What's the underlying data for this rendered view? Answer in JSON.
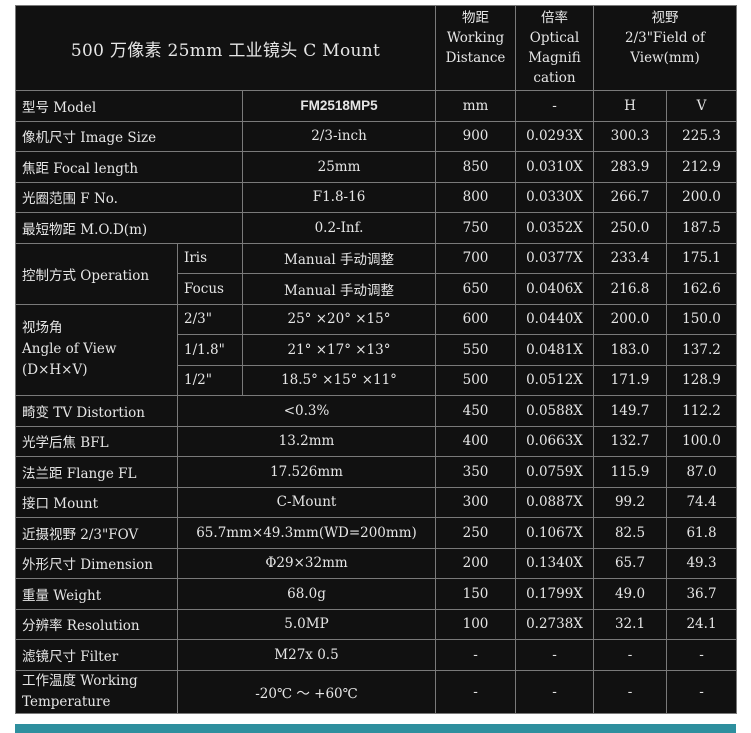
{
  "header": {
    "title": "500 万像素 25mm 工业镜头 C Mount",
    "col_distance": "物距\nWorking\nDistance",
    "col_magnification": "倍率\nOptical\nMagnifi\ncation",
    "col_fov": "视野\n2/3\"Field of\nView(mm)"
  },
  "rows": [
    {
      "label": "型号 Model",
      "value": "FM2518MP5",
      "d": "mm",
      "m": "-",
      "h": "H",
      "v": "V"
    },
    {
      "label": "像机尺寸 Image Size",
      "value": "2/3-inch",
      "d": "900",
      "m": "0.0293X",
      "h": "300.3",
      "v": "225.3"
    },
    {
      "label": "焦距 Focal length",
      "value": "25mm",
      "d": "850",
      "m": "0.0310X",
      "h": "283.9",
      "v": "212.9"
    },
    {
      "label": "光圈范围 F No.",
      "value": "F1.8-16",
      "d": "800",
      "m": "0.0330X",
      "h": "266.7",
      "v": "200.0"
    },
    {
      "label": "最短物距 M.O.D(m)",
      "value": "0.2-Inf.",
      "d": "750",
      "m": "0.0352X",
      "h": "250.0",
      "v": "187.5"
    },
    {
      "label": "控制方式 Operation",
      "sub": "Iris",
      "value": "Manual 手动调整",
      "d": "700",
      "m": "0.0377X",
      "h": "233.4",
      "v": "175.1"
    },
    {
      "sub": "Focus",
      "value": "Manual 手动调整",
      "d": "650",
      "m": "0.0406X",
      "h": "216.8",
      "v": "162.6"
    },
    {
      "label": "视场角\nAngle of View\n(D×H×V)",
      "sub": "2/3\"",
      "value": "25° ×20° ×15°",
      "d": "600",
      "m": "0.0440X",
      "h": "200.0",
      "v": "150.0"
    },
    {
      "sub": "1/1.8\"",
      "value": "21° ×17° ×13°",
      "d": "550",
      "m": "0.0481X",
      "h": "183.0",
      "v": "137.2"
    },
    {
      "sub": "1/2\"",
      "value": "18.5° ×15° ×11°",
      "d": "500",
      "m": "0.0512X",
      "h": "171.9",
      "v": "128.9"
    },
    {
      "label": "畸变 TV Distortion",
      "value": "<0.3%",
      "d": "450",
      "m": "0.0588X",
      "h": "149.7",
      "v": "112.2"
    },
    {
      "label": "光学后焦 BFL",
      "value": "13.2mm",
      "d": "400",
      "m": "0.0663X",
      "h": "132.7",
      "v": "100.0"
    },
    {
      "label": "法兰距 Flange FL",
      "value": "17.526mm",
      "d": "350",
      "m": "0.0759X",
      "h": "115.9",
      "v": "87.0"
    },
    {
      "label": "接口 Mount",
      "value": "C-Mount",
      "d": "300",
      "m": "0.0887X",
      "h": "99.2",
      "v": "74.4"
    },
    {
      "label": "近摄视野 2/3\"FOV",
      "value": "65.7mm×49.3mm(WD=200mm)",
      "d": "250",
      "m": "0.1067X",
      "h": "82.5",
      "v": "61.8"
    },
    {
      "label": "外形尺寸 Dimension",
      "value": "Φ29×32mm",
      "d": "200",
      "m": "0.1340X",
      "h": "65.7",
      "v": "49.3"
    },
    {
      "label": "重量 Weight",
      "value": "68.0g",
      "d": "150",
      "m": "0.1799X",
      "h": "49.0",
      "v": "36.7"
    },
    {
      "label": "分辨率 Resolution",
      "value": "5.0MP",
      "d": "100",
      "m": "0.2738X",
      "h": "32.1",
      "v": "24.1"
    },
    {
      "label": "滤镜尺寸 Filter",
      "value": "M27x 0.5",
      "d": "-",
      "m": "-",
      "h": "-",
      "v": "-"
    },
    {
      "label": "工作温度 Working\nTemperature",
      "value": "-20℃ ～ +60℃",
      "d": "-",
      "m": "-",
      "h": "-",
      "v": "-"
    }
  ],
  "colors": {
    "background": "#111111",
    "border": "#7a7a7a",
    "text": "#e6e6e6",
    "accent_bar": "#2e8f9e"
  }
}
